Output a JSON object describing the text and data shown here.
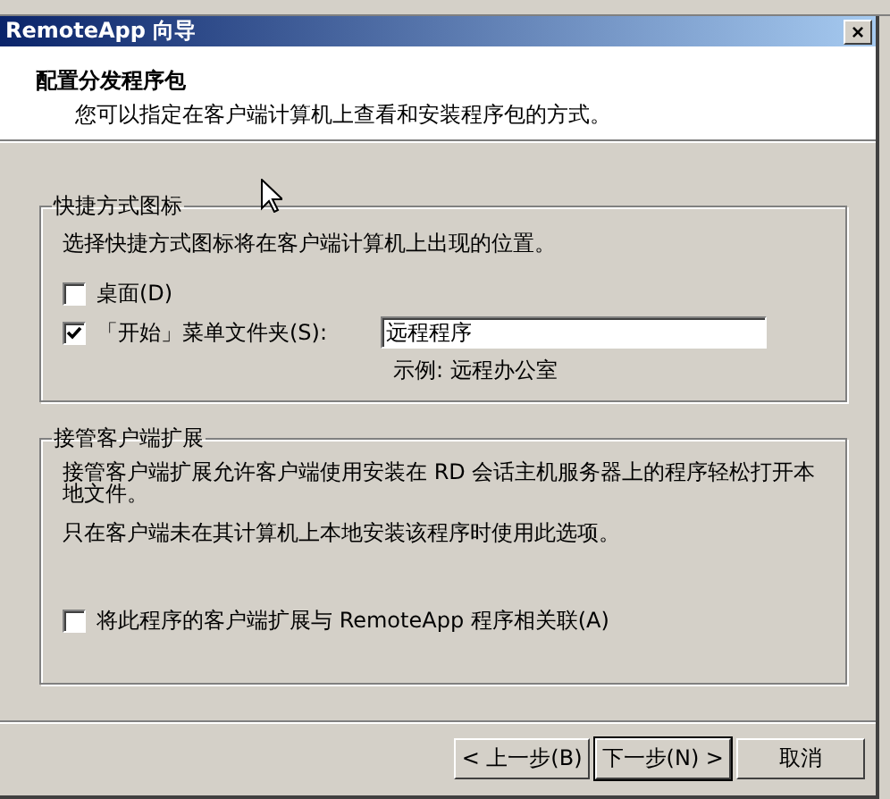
{
  "window": {
    "title": "RemoteApp 向导",
    "close": "×"
  },
  "header": {
    "title": "配置分发程序包",
    "subtitle": "您可以指定在客户端计算机上查看和安装程序包的方式。"
  },
  "groups": [
    {
      "kind": "shortcuts",
      "title": "快捷方式图标",
      "description": "选择快捷方式图标将在客户端计算机上出现的位置。",
      "options": [
        {
          "label": "桌面(D)",
          "checked": false
        },
        {
          "label": "「开始」菜单文件夹(S):",
          "checked": true,
          "value": "远程程序",
          "example": "示例: 远程办公室"
        }
      ]
    },
    {
      "kind": "extensions",
      "title": "接管客户端扩展",
      "paragraphs": [
        "接管客户端扩展允许客户端使用安装在 RD 会话主机服务器上的程序轻松打开本地文件。",
        "只在客户端未在其计算机上本地安装该程序时使用此选项。"
      ],
      "options": [
        {
          "label": "将此程序的客户端扩展与 RemoteApp 程序相关联(A)",
          "checked": false
        }
      ]
    }
  ],
  "buttons": [
    {
      "label": "< 上一步(B)",
      "default": false
    },
    {
      "label": "下一步(N) >",
      "default": true
    },
    {
      "label": "取消",
      "default": false
    }
  ]
}
